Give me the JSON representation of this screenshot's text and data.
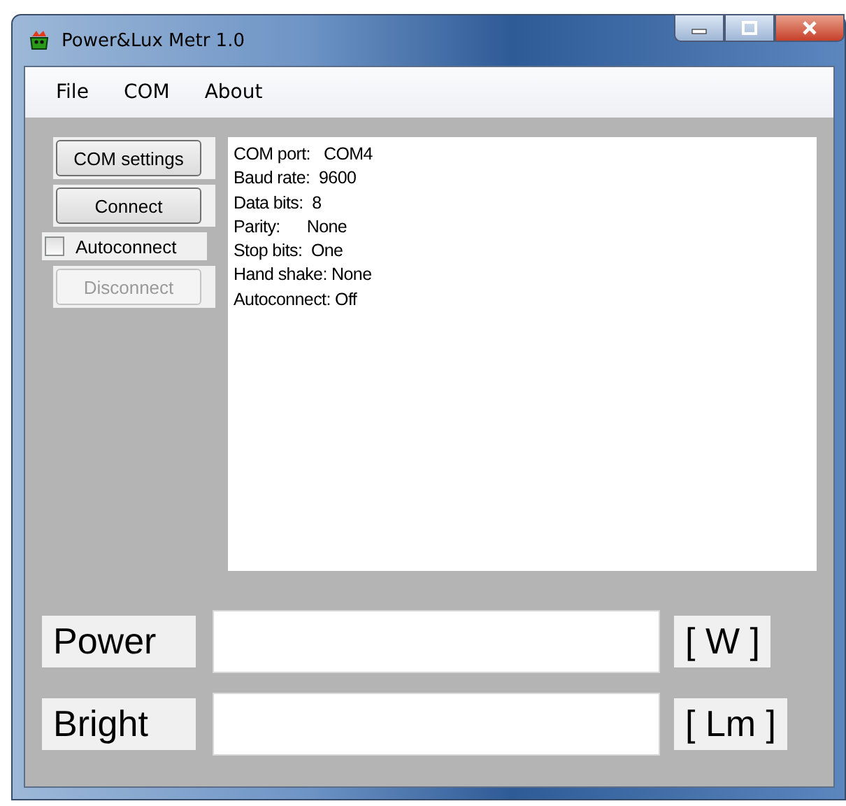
{
  "window": {
    "title": "Power&Lux Metr 1.0"
  },
  "menu": [
    "File",
    "COM",
    "About"
  ],
  "buttons": [
    {
      "label": "COM settings",
      "disabled": false
    },
    {
      "label": "Connect",
      "disabled": false
    }
  ],
  "autoconnect": {
    "label": "Autoconnect",
    "checked": false
  },
  "disconnect": {
    "label": "Disconnect",
    "disabled": true
  },
  "info_lines": [
    "COM port:   COM4",
    "Baud rate:  9600",
    "Data bits:  8",
    "Parity:      None",
    "Stop bits:  One",
    "Hand shake: None",
    "Autoconnect: Off"
  ],
  "readings": [
    {
      "label": "Power",
      "unit": "[ W ]"
    },
    {
      "label": "Bright",
      "unit": "[ Lm ]"
    }
  ]
}
